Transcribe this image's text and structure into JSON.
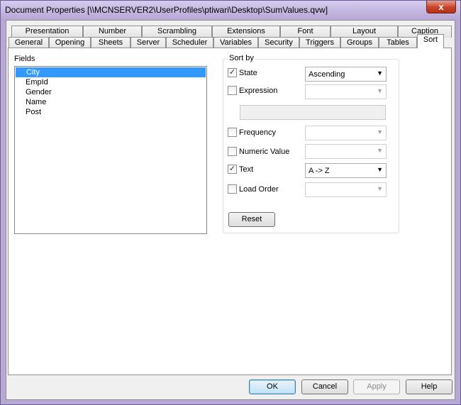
{
  "window": {
    "title": "Document Properties [\\\\MCNSERVER2\\UserProfiles\\ptiwari\\Desktop\\SumValues.qvw]",
    "close_label": "x"
  },
  "tabs_row1": [
    "Presentation",
    "Number",
    "Scrambling",
    "Extensions",
    "Font",
    "Layout",
    "Caption"
  ],
  "tabs_row2": [
    "General",
    "Opening",
    "Sheets",
    "Server",
    "Scheduler",
    "Variables",
    "Security",
    "Triggers",
    "Groups",
    "Tables",
    "Sort"
  ],
  "active_tab": "Sort",
  "fields": {
    "label": "Fields",
    "items": [
      "City",
      "EmpId",
      "Gender",
      "Name",
      "Post"
    ],
    "selected": "City"
  },
  "sort_by": {
    "label": "Sort by",
    "state": {
      "label": "State",
      "checked": true,
      "value": "Ascending"
    },
    "expression": {
      "label": "Expression",
      "checked": false,
      "value": ""
    },
    "frequency": {
      "label": "Frequency",
      "checked": false,
      "value": ""
    },
    "numeric_value": {
      "label": "Numeric Value",
      "checked": false,
      "value": ""
    },
    "text": {
      "label": "Text",
      "checked": true,
      "value": "A -> Z"
    },
    "load_order": {
      "label": "Load Order",
      "checked": false,
      "value": ""
    },
    "reset_label": "Reset"
  },
  "footer": {
    "ok": "OK",
    "cancel": "Cancel",
    "apply": "Apply",
    "help": "Help"
  }
}
